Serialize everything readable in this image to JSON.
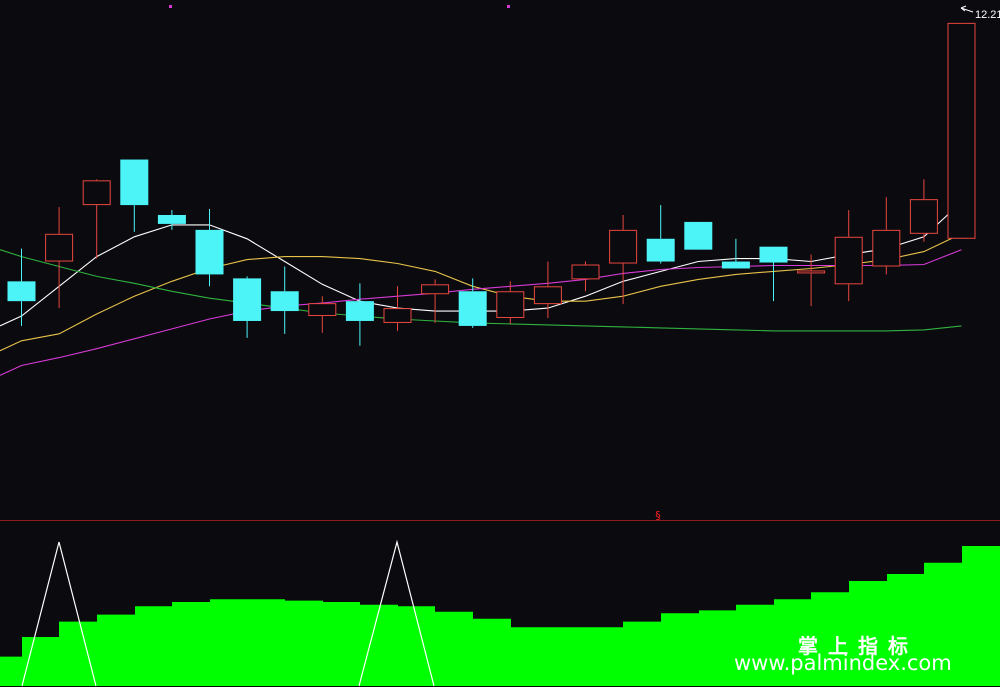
{
  "colors": {
    "background": "#0b0a0f",
    "up_candle": "#e8473f",
    "down_candle": "#4cf4f7",
    "ma5": "#ffffff",
    "ma10": "#e8c24a",
    "ma20": "#d63ad6",
    "ma60": "#2fb33f",
    "indicator_fill": "#00ff00",
    "indicator_line": "#ffffff",
    "divider": "#8a1c1c",
    "marker": "#d43ad4",
    "signal": "#ff2020"
  },
  "labels": {
    "last_price": "12.21",
    "signal_glyph": "§",
    "watermark_cn": "掌上指标",
    "watermark_url": "www.palmindex.com"
  },
  "chart_data": [
    {
      "type": "candlestick",
      "ylim": [
        8.2,
        12.35
      ],
      "x": [
        1,
        2,
        3,
        4,
        5,
        6,
        7,
        8,
        9,
        10,
        11,
        12,
        13,
        14,
        15,
        16,
        17,
        18,
        19,
        20,
        21,
        22,
        23,
        24,
        25,
        26
      ],
      "open": [
        9.6,
        9.8,
        10.37,
        10.83,
        10.27,
        10.12,
        9.63,
        9.5,
        9.25,
        9.4,
        9.18,
        9.47,
        9.5,
        9.23,
        9.37,
        9.62,
        9.78,
        10.03,
        10.2,
        9.8,
        9.95,
        9.68,
        9.57,
        9.75,
        10.08,
        10.03
      ],
      "high": [
        9.93,
        10.35,
        10.63,
        10.83,
        10.32,
        10.33,
        9.65,
        9.75,
        9.45,
        9.58,
        9.55,
        9.62,
        9.63,
        9.6,
        9.8,
        9.8,
        10.27,
        10.37,
        10.08,
        10.03,
        9.95,
        9.87,
        10.32,
        10.45,
        10.63,
        12.21
      ],
      "low": [
        9.15,
        9.33,
        9.83,
        10.1,
        10.12,
        9.55,
        9.03,
        9.07,
        9.08,
        8.95,
        9.1,
        9.18,
        9.13,
        9.17,
        9.23,
        9.5,
        9.37,
        9.78,
        9.93,
        9.77,
        9.4,
        9.35,
        9.4,
        9.67,
        10.0,
        10.33
      ],
      "close": [
        9.4,
        10.08,
        10.62,
        10.37,
        10.18,
        9.67,
        9.2,
        9.3,
        9.38,
        9.2,
        9.33,
        9.57,
        9.15,
        9.5,
        9.55,
        9.77,
        10.12,
        9.8,
        9.92,
        9.73,
        9.79,
        9.71,
        10.05,
        10.12,
        10.43,
        12.21
      ]
    },
    {
      "type": "line",
      "x": [
        1,
        2,
        3,
        4,
        5,
        6,
        7,
        8,
        9,
        10,
        11,
        12,
        13,
        14,
        15,
        16,
        17,
        18,
        19,
        20,
        21,
        22,
        23,
        24,
        25,
        26
      ],
      "ylim": [
        8.2,
        12.35
      ],
      "series": [
        {
          "values": [
            9.25,
            9.55,
            9.85,
            10.05,
            10.17,
            10.17,
            10.03,
            9.8,
            9.57,
            9.4,
            9.33,
            9.3,
            9.3,
            9.3,
            9.33,
            9.45,
            9.6,
            9.7,
            9.8,
            9.83,
            9.83,
            9.8,
            9.87,
            9.93,
            10.05,
            10.4
          ]
        },
        {
          "values": [
            9.0,
            9.07,
            9.27,
            9.45,
            9.6,
            9.73,
            9.82,
            9.85,
            9.85,
            9.83,
            9.78,
            9.7,
            9.55,
            9.45,
            9.4,
            9.4,
            9.45,
            9.55,
            9.62,
            9.67,
            9.7,
            9.73,
            9.77,
            9.82,
            9.9,
            10.08
          ]
        },
        {
          "values": [
            8.75,
            8.83,
            8.92,
            9.02,
            9.12,
            9.22,
            9.3,
            9.35,
            9.38,
            9.42,
            9.45,
            9.48,
            9.52,
            9.55,
            9.58,
            9.62,
            9.68,
            9.72,
            9.74,
            9.75,
            9.76,
            9.76,
            9.76,
            9.76,
            9.77,
            9.92
          ]
        },
        {
          "values": [
            9.85,
            9.75,
            9.65,
            9.58,
            9.5,
            9.43,
            9.38,
            9.33,
            9.28,
            9.25,
            9.22,
            9.2,
            9.18,
            9.17,
            9.16,
            9.15,
            9.14,
            9.13,
            9.12,
            9.11,
            9.1,
            9.1,
            9.1,
            9.1,
            9.11,
            9.15
          ]
        }
      ]
    },
    {
      "type": "area",
      "ylim": [
        0,
        100
      ],
      "x": [
        0,
        1,
        2,
        3,
        4,
        5,
        6,
        7,
        8,
        9,
        10,
        11,
        12,
        13,
        14,
        15,
        16,
        17,
        18,
        19,
        20,
        21,
        22,
        23,
        24,
        25,
        26
      ],
      "series": [
        {
          "values": [
            21,
            35,
            46,
            51,
            57,
            60,
            62,
            62,
            61,
            60,
            58,
            57,
            53,
            48,
            42,
            42,
            42,
            46,
            52,
            54,
            58,
            62,
            67,
            75,
            80,
            88,
            100
          ]
        }
      ]
    }
  ]
}
